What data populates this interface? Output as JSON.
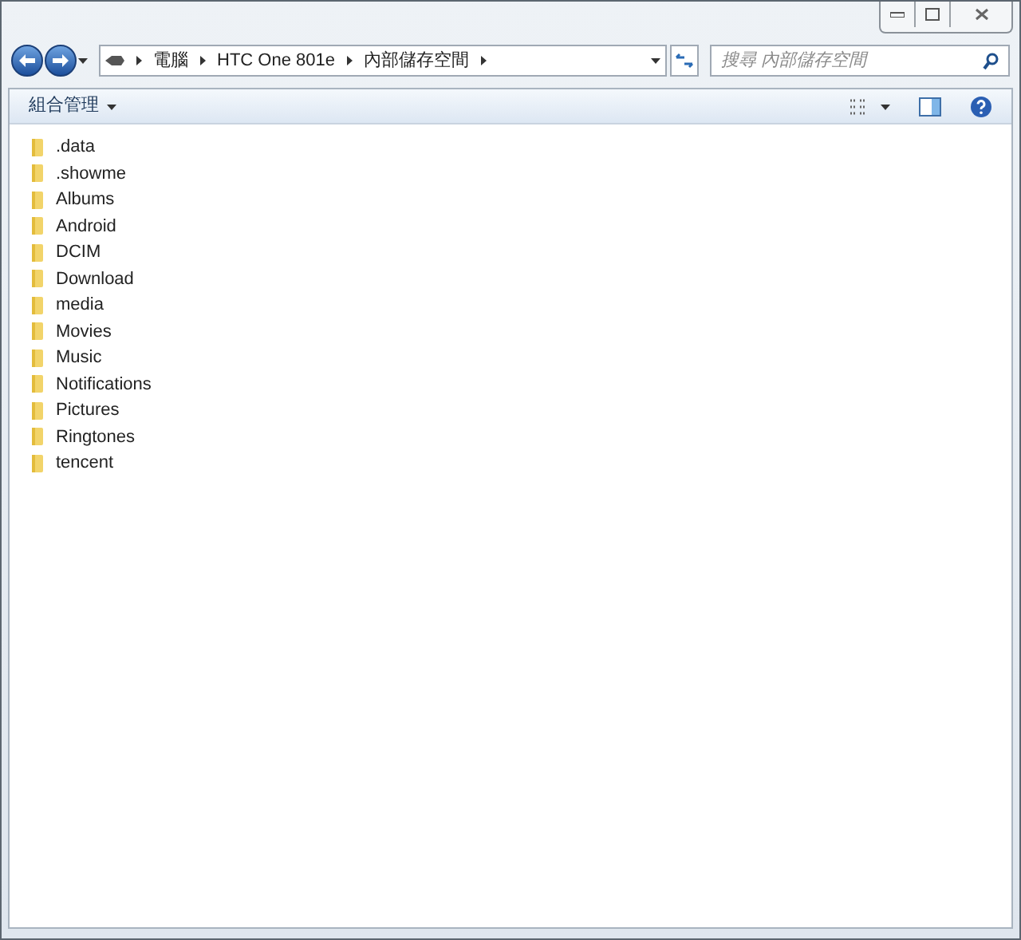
{
  "address_bar": {
    "breadcrumbs": [
      "電腦",
      "HTC One 801e",
      "內部儲存空間"
    ]
  },
  "search": {
    "placeholder": "搜尋 內部儲存空間"
  },
  "toolbar": {
    "organize": "組合管理"
  },
  "files": [
    {
      "name": ".data"
    },
    {
      "name": ".showme"
    },
    {
      "name": "Albums"
    },
    {
      "name": "Android"
    },
    {
      "name": "DCIM"
    },
    {
      "name": "Download"
    },
    {
      "name": "media"
    },
    {
      "name": "Movies"
    },
    {
      "name": "Music"
    },
    {
      "name": "Notifications"
    },
    {
      "name": "Pictures"
    },
    {
      "name": "Ringtones"
    },
    {
      "name": "tencent"
    }
  ]
}
